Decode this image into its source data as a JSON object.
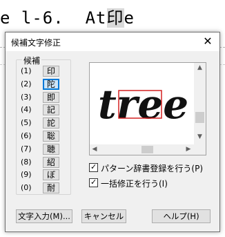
{
  "document": {
    "line_before": "e l-6.  At",
    "selected": "印",
    "line_after": "e"
  },
  "dialog": {
    "title": "候補文字修正",
    "close_glyph": "✕",
    "candidates_label": "候補",
    "candidates": [
      {
        "num": "(1)",
        "char": "印",
        "selected": false
      },
      {
        "num": "(2)",
        "char": "陀",
        "selected": true
      },
      {
        "num": "(3)",
        "char": "即",
        "selected": false
      },
      {
        "num": "(4)",
        "char": "記",
        "selected": false
      },
      {
        "num": "(5)",
        "char": "詑",
        "selected": false
      },
      {
        "num": "(6)",
        "char": "聡",
        "selected": false
      },
      {
        "num": "(7)",
        "char": "聴",
        "selected": false
      },
      {
        "num": "(8)",
        "char": "紹",
        "selected": false
      },
      {
        "num": "(9)",
        "char": "ぼ",
        "selected": false
      },
      {
        "num": "(0)",
        "char": "耐",
        "selected": false
      }
    ],
    "preview_word": "tree",
    "scroll_up": "▲",
    "scroll_down": "▼",
    "scroll_left": "◀",
    "scroll_right": "▶",
    "check_pattern": {
      "label": "パターン辞書登録を行う(P)",
      "checked": true,
      "mark": "✓"
    },
    "check_bulk": {
      "label": "一括修正を行う(I)",
      "checked": true,
      "mark": "✓"
    },
    "buttons": {
      "text_input": "文字入力(M)...",
      "cancel": "キャンセル",
      "help": "ヘルプ(H)"
    }
  }
}
